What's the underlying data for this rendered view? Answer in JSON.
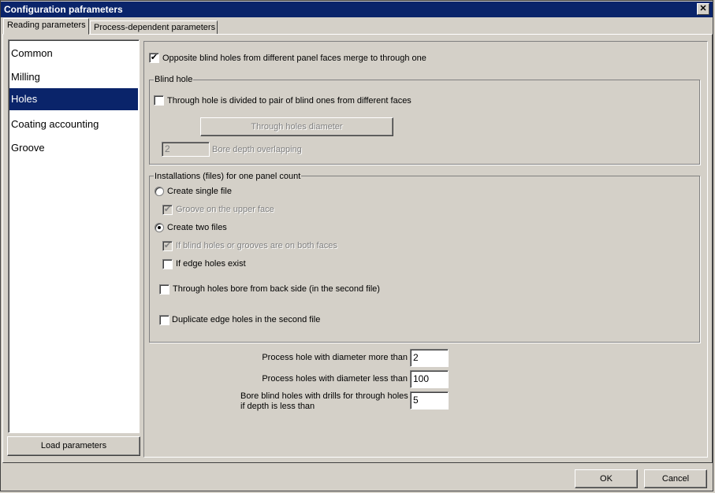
{
  "window": {
    "title": "Configuration paframeters",
    "close_glyph": "✕"
  },
  "tabs": [
    "Reading parameters",
    "Process-dependent parameters"
  ],
  "sidebar": {
    "items": [
      "Common",
      "Milling",
      "Holes",
      "Coating accounting",
      "Groove"
    ],
    "selected": "Holes",
    "load_button": "Load parameters"
  },
  "holes": {
    "merge_checkbox": {
      "label": "Opposite blind holes from different panel faces merge to through one",
      "checked": true
    },
    "blind_hole": {
      "legend": "Blind hole",
      "divide_checkbox": {
        "label": "Through hole is divided to pair of blind ones from different faces",
        "checked": false
      },
      "diameter_button": "Through holes diameter",
      "overlap_value": "2",
      "overlap_label": "Bore depth overlapping"
    },
    "installations": {
      "legend": "Installations (files) for one panel count",
      "single_file": {
        "label": "Create single file",
        "selected": false
      },
      "groove_upper": {
        "label": "Groove on the upper face",
        "checked": true,
        "disabled": true
      },
      "two_files": {
        "label": "Create two files",
        "selected": true
      },
      "both_faces": {
        "label": "If blind holes or grooves are on both faces",
        "checked": true,
        "disabled": true
      },
      "edge_holes": {
        "label": "If edge holes exist",
        "checked": false
      },
      "through_back": {
        "label": "Through holes bore from back side (in the second file)",
        "checked": false
      },
      "duplicate_edge": {
        "label": "Duplicate edge holes in the second file",
        "checked": false
      }
    },
    "params": [
      {
        "label": "Process hole with diameter more than",
        "value": "2"
      },
      {
        "label": "Process holes with diameter less than",
        "value": "100"
      },
      {
        "label_line1": "Bore blind holes with drills for through holes",
        "label_line2": "if depth is less than",
        "value": "5"
      }
    ]
  },
  "footer": {
    "ok": "OK",
    "cancel": "Cancel"
  },
  "check_glyph": "✔"
}
